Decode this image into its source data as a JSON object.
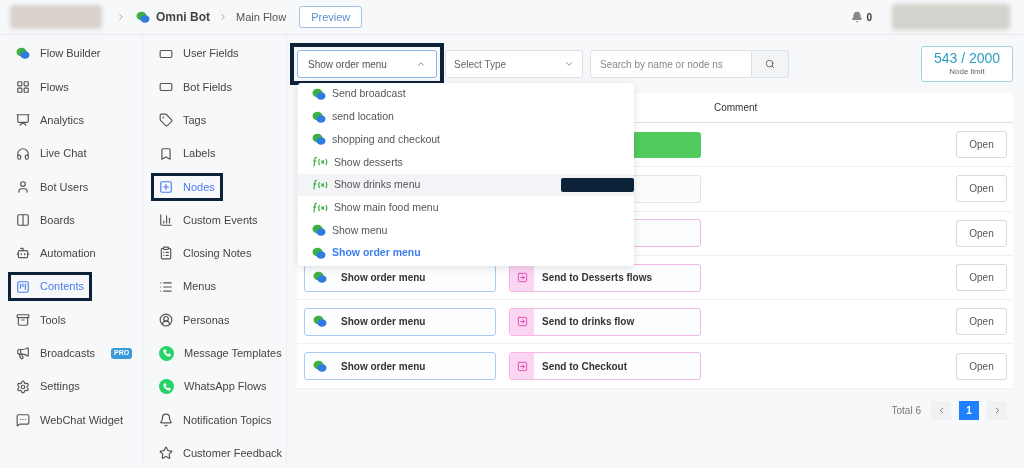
{
  "breadcrumb": {
    "bot": "Omni Bot",
    "flow": "Main Flow",
    "preview": "Preview"
  },
  "notifications": {
    "count": "0"
  },
  "sidebar": [
    {
      "label": "Flow Builder",
      "selected": false,
      "highlighted": false
    },
    {
      "label": "Flows",
      "selected": false,
      "highlighted": false
    },
    {
      "label": "Analytics",
      "selected": false,
      "highlighted": false
    },
    {
      "label": "Live Chat",
      "selected": false,
      "highlighted": false
    },
    {
      "label": "Bot Users",
      "selected": false,
      "highlighted": false
    },
    {
      "label": "Boards",
      "selected": false,
      "highlighted": false
    },
    {
      "label": "Automation",
      "selected": false,
      "highlighted": false
    },
    {
      "label": "Contents",
      "selected": true,
      "highlighted": true
    },
    {
      "label": "Tools",
      "selected": false,
      "highlighted": false
    },
    {
      "label": "Broadcasts",
      "selected": false,
      "highlighted": false,
      "badge": "PRO"
    },
    {
      "label": "Settings",
      "selected": false,
      "highlighted": false
    },
    {
      "label": "WebChat Widget",
      "selected": false,
      "highlighted": false
    }
  ],
  "subnav": [
    {
      "label": "User Fields",
      "selected": false,
      "highlighted": false
    },
    {
      "label": "Bot Fields",
      "selected": false,
      "highlighted": false
    },
    {
      "label": "Tags",
      "selected": false,
      "highlighted": false
    },
    {
      "label": "Labels",
      "selected": false,
      "highlighted": false
    },
    {
      "label": "Nodes",
      "selected": true,
      "highlighted": true
    },
    {
      "label": "Custom Events",
      "selected": false,
      "highlighted": false
    },
    {
      "label": "Closing Notes",
      "selected": false,
      "highlighted": false
    },
    {
      "label": "Menus",
      "selected": false,
      "highlighted": false
    },
    {
      "label": "Personas",
      "selected": false,
      "highlighted": false
    },
    {
      "label": "Message Templates",
      "selected": false,
      "highlighted": false
    },
    {
      "label": "WhatsApp Flows",
      "selected": false,
      "highlighted": false
    },
    {
      "label": "Notification Topics",
      "selected": false,
      "highlighted": false
    },
    {
      "label": "Customer Feedback",
      "selected": false,
      "highlighted": false
    }
  ],
  "filters": {
    "flow_select": {
      "value": "Show order menu",
      "expanded": true,
      "highlighted": true
    },
    "type_select": {
      "placeholder": "Select Type"
    },
    "search": {
      "placeholder": "Search by name or node ns"
    }
  },
  "node_limit": {
    "count": "543 / 2000",
    "label": "Node limit"
  },
  "flow_options": [
    {
      "label": "Send broadcast",
      "kind": "chat",
      "selected": false,
      "hovered": false
    },
    {
      "label": "send location",
      "kind": "chat",
      "selected": false,
      "hovered": false
    },
    {
      "label": "shopping and checkout",
      "kind": "chat",
      "selected": false,
      "hovered": false
    },
    {
      "label": "Show desserts",
      "kind": "function",
      "selected": false,
      "hovered": false
    },
    {
      "label": "Show drinks menu",
      "kind": "function",
      "selected": false,
      "hovered": true
    },
    {
      "label": "Show main food menu",
      "kind": "function",
      "selected": false,
      "hovered": false
    },
    {
      "label": "Show menu",
      "kind": "chat",
      "selected": false,
      "hovered": false
    },
    {
      "label": "Show order menu",
      "kind": "chat",
      "selected": true,
      "hovered": false
    }
  ],
  "table": {
    "columns": [
      "Comment"
    ],
    "rows": [
      {
        "comment": {
          "kind": "solid"
        },
        "action": "Open"
      },
      {
        "comment": {
          "kind": "plain"
        },
        "action": "Open"
      },
      {
        "comment": {
          "kind": "goto"
        },
        "action": "Open"
      },
      {
        "node": "Show order menu",
        "comment": {
          "kind": "goto",
          "text": "Send to Desserts flows"
        },
        "action": "Open"
      },
      {
        "node": "Show order menu",
        "comment": {
          "kind": "goto",
          "text": "Send to drinks flow"
        },
        "action": "Open"
      },
      {
        "node": "Show order menu",
        "comment": {
          "kind": "goto",
          "text": "Send to Checkout"
        },
        "action": "Open"
      }
    ]
  },
  "pagination": {
    "total": "Total 6",
    "pages": [
      {
        "label": "1",
        "selected": true
      }
    ]
  }
}
